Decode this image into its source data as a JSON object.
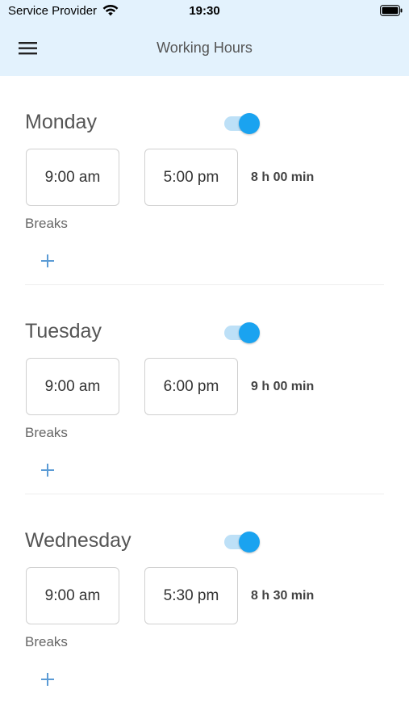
{
  "status_bar": {
    "carrier": "Service Provider",
    "time": "19:30",
    "wifi_icon": "wifi-icon",
    "battery_icon": "battery-icon"
  },
  "app_bar": {
    "title": "Working Hours",
    "menu_icon": "menu-icon"
  },
  "colors": {
    "header_bg": "#e3f2fd",
    "toggle_on": "#1aa3f0",
    "toggle_track": "#bde0f7",
    "add_icon": "#5b9bd5"
  },
  "days": [
    {
      "name": "Monday",
      "enabled": true,
      "start": "9:00 am",
      "end": "5:00 pm",
      "duration": "8 h 00 min",
      "breaks_label": "Breaks"
    },
    {
      "name": "Tuesday",
      "enabled": true,
      "start": "9:00 am",
      "end": "6:00 pm",
      "duration": "9 h 00 min",
      "breaks_label": "Breaks"
    },
    {
      "name": "Wednesday",
      "enabled": true,
      "start": "9:00 am",
      "end": "5:30 pm",
      "duration": "8 h 30 min",
      "breaks_label": "Breaks"
    }
  ]
}
